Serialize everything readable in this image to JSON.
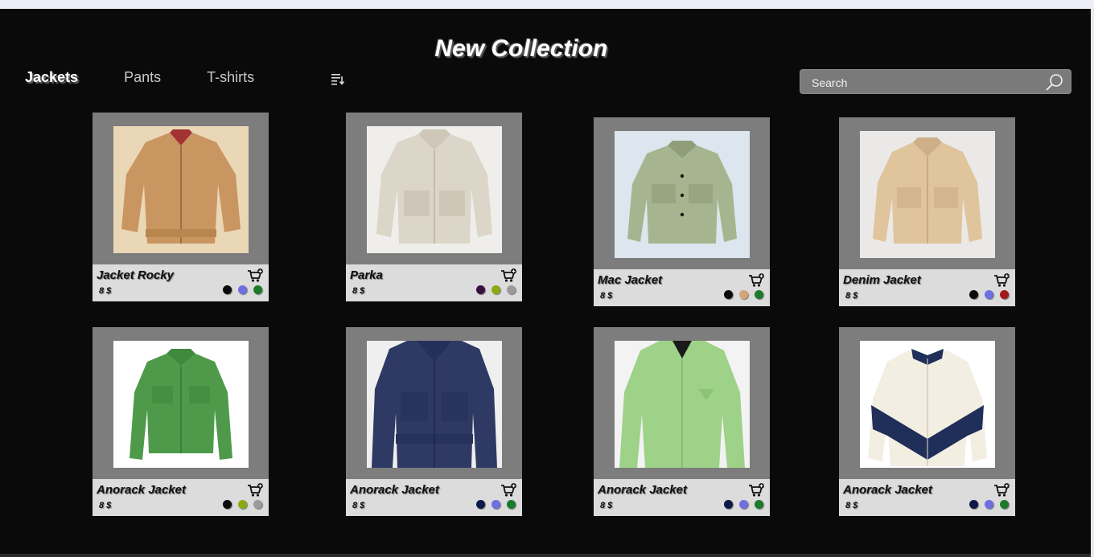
{
  "page": {
    "title": "New Collection"
  },
  "nav": {
    "tabs": [
      {
        "label": "Jackets",
        "active": true
      },
      {
        "label": "Pants"
      },
      {
        "label": "T-shirts"
      }
    ]
  },
  "search": {
    "placeholder": "Search",
    "value": ""
  },
  "products": [
    {
      "name": "Jacket Rocky",
      "price": "8 $",
      "image": "tan-pinstripe-jacket",
      "colors": [
        "#0b0b0b",
        "#6f6fe0",
        "#1c7a2c"
      ]
    },
    {
      "name": "Parka",
      "price": "8 $",
      "image": "cream-cropped-jacket",
      "colors": [
        "#35103f",
        "#8aaa14",
        "#9a9a9a"
      ]
    },
    {
      "name": "Mac Jacket",
      "price": "8 $",
      "image": "sage-green-jacket",
      "colors": [
        "#0b0b0b",
        "#d4a47a",
        "#1c7a2c"
      ]
    },
    {
      "name": "Denim Jacket",
      "price": "8 $",
      "image": "beige-cropped-jacket",
      "colors": [
        "#0b0b0b",
        "#6f6fe0",
        "#a31a1a"
      ]
    },
    {
      "name": "Anorack Jacket",
      "price": "8 $",
      "image": "green-pocket-jacket",
      "colors": [
        "#0b0b0b",
        "#8aaa14",
        "#9a9a9a"
      ]
    },
    {
      "name": "Anorack Jacket",
      "price": "8 $",
      "image": "indigo-denim-jacket",
      "colors": [
        "#0c1a4a",
        "#6f6fe0",
        "#1c7a2c"
      ]
    },
    {
      "name": "Anorack Jacket",
      "price": "8 $",
      "image": "mint-zip-jacket",
      "colors": [
        "#0c1a4a",
        "#6f6fe0",
        "#1c7a2c"
      ]
    },
    {
      "name": "Anorack Jacket",
      "price": "8 $",
      "image": "fleece-colorblock-jacket",
      "colors": [
        "#0c1a4a",
        "#6f6fe0",
        "#1c7a2c"
      ]
    }
  ]
}
